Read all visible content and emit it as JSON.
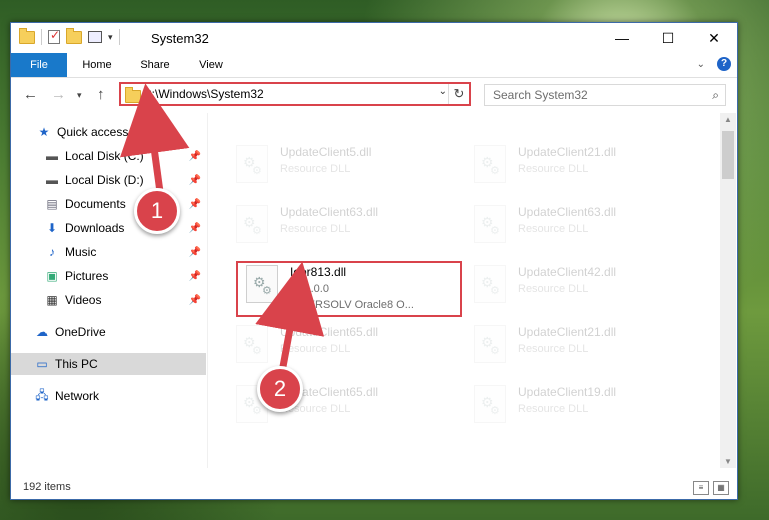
{
  "window": {
    "title": "System32"
  },
  "window_buttons": {
    "minimize": "—",
    "maximize": "☐",
    "close": "✕"
  },
  "ribbon": {
    "tabs": [
      "File",
      "Home",
      "Share",
      "View"
    ]
  },
  "navigation": {
    "address": "C:\\Windows\\System32",
    "search_placeholder": "Search System32"
  },
  "sidebar": {
    "items": [
      {
        "label": "Quick access",
        "icon": "star-icon"
      },
      {
        "label": "Local Disk (C:)",
        "icon": "drive-icon",
        "pinned": true
      },
      {
        "label": "Local Disk (D:)",
        "icon": "drive-icon",
        "pinned": true
      },
      {
        "label": "Documents",
        "icon": "document-icon",
        "pinned": true
      },
      {
        "label": "Downloads",
        "icon": "download-icon",
        "pinned": true
      },
      {
        "label": "Music",
        "icon": "music-icon",
        "pinned": true
      },
      {
        "label": "Pictures",
        "icon": "picture-icon",
        "pinned": true
      },
      {
        "label": "Videos",
        "icon": "video-icon",
        "pinned": true
      },
      {
        "label": "OneDrive",
        "icon": "cloud-icon"
      },
      {
        "label": "This PC",
        "icon": "computer-icon",
        "selected": true
      },
      {
        "label": "Network",
        "icon": "network-icon"
      }
    ]
  },
  "files": [
    {
      "name": "UpdateClient5.dll",
      "desc": "Resource DLL",
      "faded": true
    },
    {
      "name": "UpdateClient21.dll",
      "desc": "Resource DLL",
      "faded": true
    },
    {
      "name": "UpdateClient63.dll",
      "desc": "Resource DLL",
      "faded": true
    },
    {
      "name": "UpdateClient63.dll",
      "desc": "Resource DLL",
      "faded": true
    },
    {
      "name": "Ioor813.dll",
      "desc": "3.11.0.0",
      "desc2": "INTERSOLV Oracle8 O...",
      "faded": false
    },
    {
      "name": "UpdateClient42.dll",
      "desc": "Resource DLL",
      "faded": true
    },
    {
      "name": "UpdateClient65.dll",
      "desc": "Resource DLL",
      "faded": true
    },
    {
      "name": "UpdateClient21.dll",
      "desc": "Resource DLL",
      "faded": true
    },
    {
      "name": "UpdateClient65.dll",
      "desc": "Resource DLL",
      "faded": true
    },
    {
      "name": "UpdateClient19.dll",
      "desc": "Resource DLL",
      "faded": true
    }
  ],
  "status": {
    "item_count": "192 items"
  },
  "callouts": [
    "1",
    "2"
  ],
  "colors": {
    "accent": "#1979ca",
    "highlight": "#d9434b"
  }
}
